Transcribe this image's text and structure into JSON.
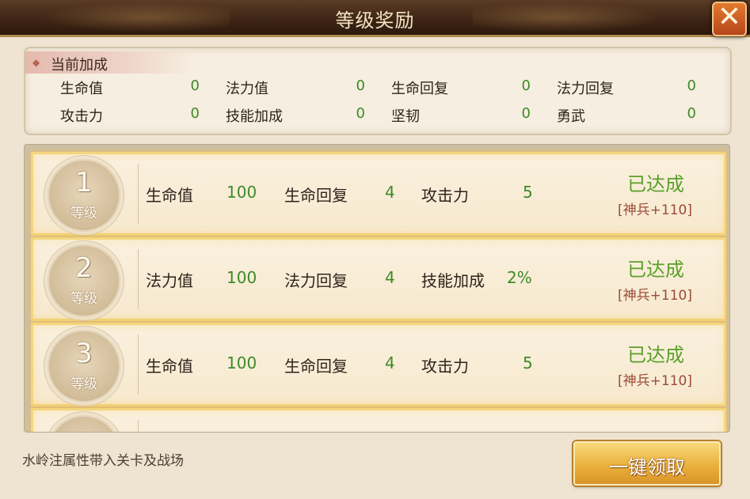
{
  "window": {
    "title": "等级奖励",
    "close_label": "✕"
  },
  "bonus": {
    "header": "当前加成",
    "stats": [
      {
        "label": "生命值",
        "value": "0"
      },
      {
        "label": "法力值",
        "value": "0"
      },
      {
        "label": "生命回复",
        "value": "0"
      },
      {
        "label": "法力回复",
        "value": "0"
      },
      {
        "label": "攻击力",
        "value": "0"
      },
      {
        "label": "技能加成",
        "value": "0"
      },
      {
        "label": "坚韧",
        "value": "0"
      },
      {
        "label": "勇武",
        "value": "0"
      }
    ]
  },
  "levels": [
    {
      "num": "1",
      "lv_label": "等级",
      "stats": [
        {
          "label": "生命值",
          "value": "100"
        },
        {
          "label": "生命回复",
          "value": "4"
        },
        {
          "label": "攻击力",
          "value": "5"
        }
      ],
      "status": "已达成",
      "reward": "[神兵+110]"
    },
    {
      "num": "2",
      "lv_label": "等级",
      "stats": [
        {
          "label": "法力值",
          "value": "100"
        },
        {
          "label": "法力回复",
          "value": "4"
        },
        {
          "label": "技能加成",
          "value": "2%"
        }
      ],
      "status": "已达成",
      "reward": "[神兵+110]"
    },
    {
      "num": "3",
      "lv_label": "等级",
      "stats": [
        {
          "label": "生命值",
          "value": "100"
        },
        {
          "label": "生命回复",
          "value": "4"
        },
        {
          "label": "攻击力",
          "value": "5"
        }
      ],
      "status": "已达成",
      "reward": "[神兵+110]"
    }
  ],
  "footer": {
    "note": "水岭注属性带入关卡及战场",
    "claim_label": "一键领取"
  },
  "colors": {
    "value_green": "#3d8a27",
    "status_green": "#5aa02a",
    "reward_red": "#9b4b37",
    "button_gold": "#eab13d"
  }
}
